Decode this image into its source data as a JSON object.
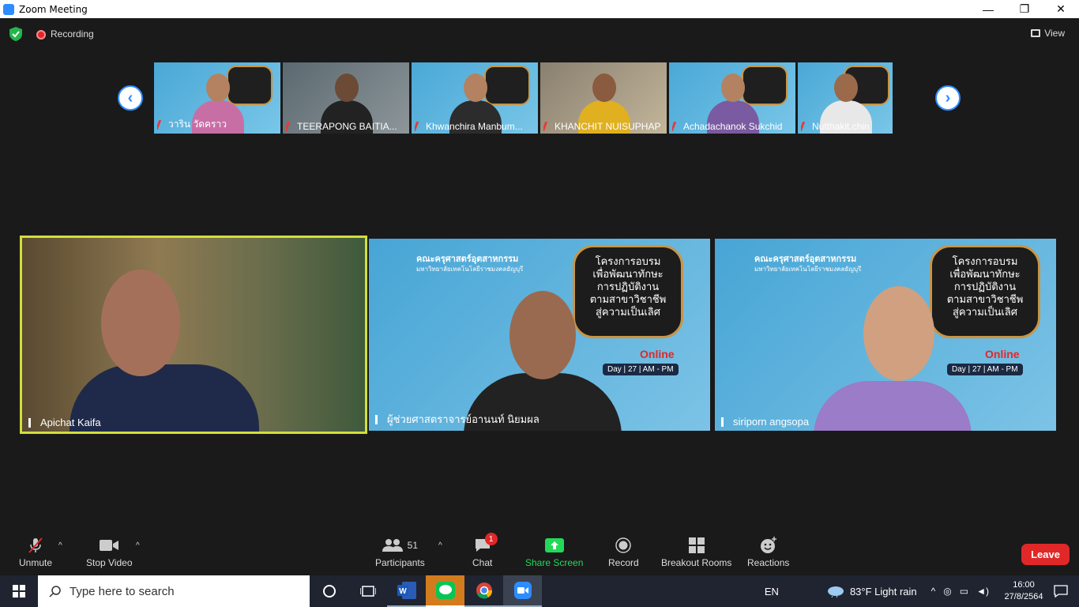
{
  "window": {
    "title": "Zoom Meeting",
    "controls": [
      "—",
      "❐",
      "✕"
    ]
  },
  "topbar": {
    "recording_label": "Recording",
    "view_label": "View"
  },
  "thumbnails": [
    {
      "name": "วาริน วัดคราว"
    },
    {
      "name": "TEERAPONG BAITIA..."
    },
    {
      "name": "Khwanchira Manbum..."
    },
    {
      "name": "KHANCHIT NUISUPHAP"
    },
    {
      "name": "Achadachanok Sukchid"
    },
    {
      "name": "Nutthakit.chin"
    }
  ],
  "nav": {
    "prev": "‹",
    "next": "›"
  },
  "tiles": [
    {
      "name": "Apichat Kaifa",
      "active": true
    },
    {
      "name": "ผู้ช่วยศาสตราจารย์อานนท์ นิยมผล"
    },
    {
      "name": "siriporn angsopa"
    }
  ],
  "slide": {
    "faculty": "คณะครุศาสตร์อุตสาหกรรม",
    "university": "มหาวิทยาลัยเทคโนโลยีราชมงคลธัญบุรี",
    "board_lines": [
      "โครงการอบรม",
      "เพื่อพัฒนาทักษะ",
      "การปฏิบัติงาน",
      "ตามสาขาวิชาชีพ",
      "สู่ความเป็นเลิศ"
    ],
    "online": "Online",
    "date": "Day | 27 | AM - PM"
  },
  "toolbar": {
    "unmute": "Unmute",
    "stop_video": "Stop Video",
    "participants": "Participants",
    "participants_count": "51",
    "chat": "Chat",
    "chat_badge": "1",
    "share_screen": "Share Screen",
    "record": "Record",
    "breakout": "Breakout Rooms",
    "reactions": "Reactions",
    "leave": "Leave",
    "share_color": "#23d959"
  },
  "taskbar": {
    "search_placeholder": "Type here to search",
    "language": "EN",
    "weather": "83°F  Light rain",
    "time": "16:00",
    "date": "27/8/2564"
  }
}
